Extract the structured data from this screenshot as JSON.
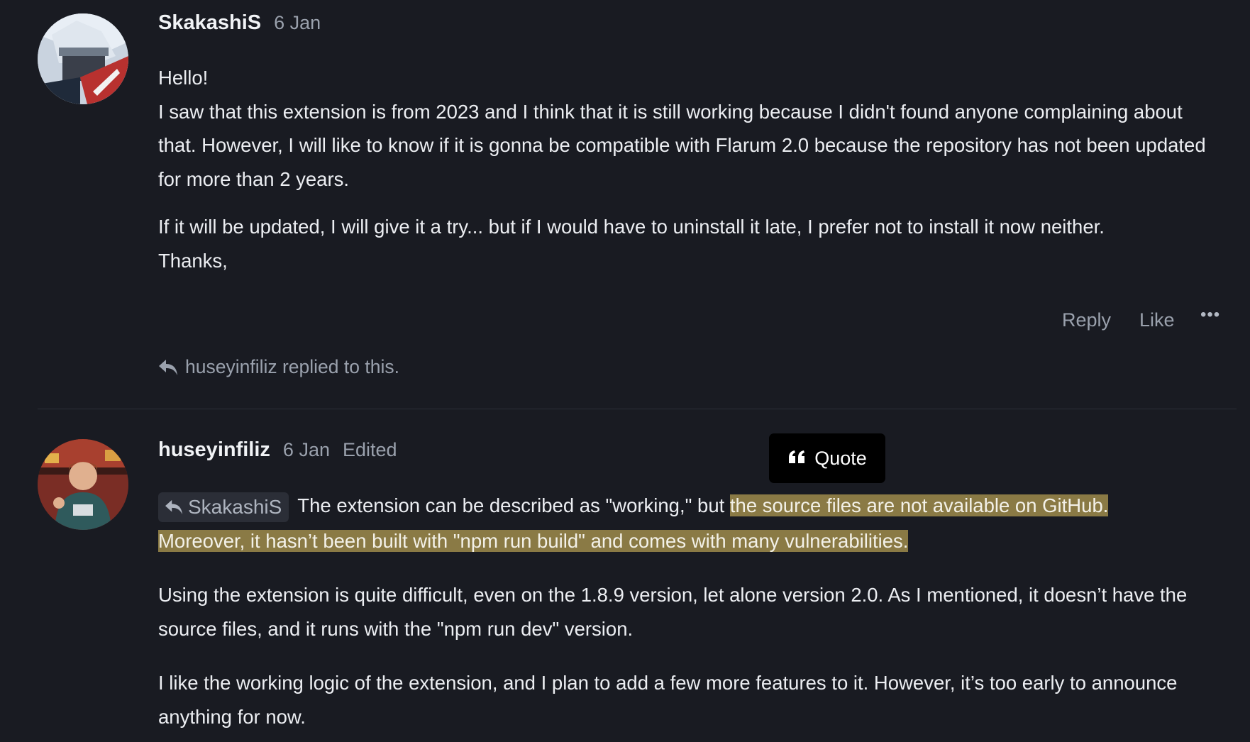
{
  "post1": {
    "username": "SkakashiS",
    "date": "6 Jan",
    "paragraphs": [
      "Hello!",
      "I saw that this extension is from 2023 and I think that it is still working because I didn't found anyone complaining about that. However, I will like to know if it is gonna be compatible with Flarum 2.0 because the repository has not been updated for more than 2 years."
    ],
    "paragraph3_line1": "If it will be updated, I will give it a try... but if I would have to uninstall it late, I prefer not to install it now neither.",
    "paragraph3_line2": "Thanks,",
    "actions": {
      "reply": "Reply",
      "like": "Like",
      "more": "•••"
    },
    "replied_notice": "huseyinfiliz replied to this."
  },
  "post2": {
    "username": "huseyinfiliz",
    "date": "6 Jan",
    "edited": "Edited",
    "mention": "SkakashiS",
    "text_before_highlight": "The extension can be described as \"working,\" but ",
    "highlight_line1": "the source files are not available on GitHub. ",
    "highlight_line2": "Moreover, it hasn’t been built with \"npm run build\" and comes with many vulnerabilities.",
    "paragraph2": "Using the extension is quite difficult, even on the 1.8.9 version, let alone version 2.0. As I mentioned, it doesn’t have the source files, and it runs with the \"npm run dev\" version.",
    "paragraph3": "I like the working logic of the extension, and I plan to add a few more features to it. However, it’s too early to announce anything for now."
  },
  "quote_tooltip": {
    "label": "Quote",
    "icon": "quote-icon"
  },
  "colors": {
    "background": "#191b22",
    "highlight": "#8a7a45",
    "muted": "#9aa1ad"
  }
}
